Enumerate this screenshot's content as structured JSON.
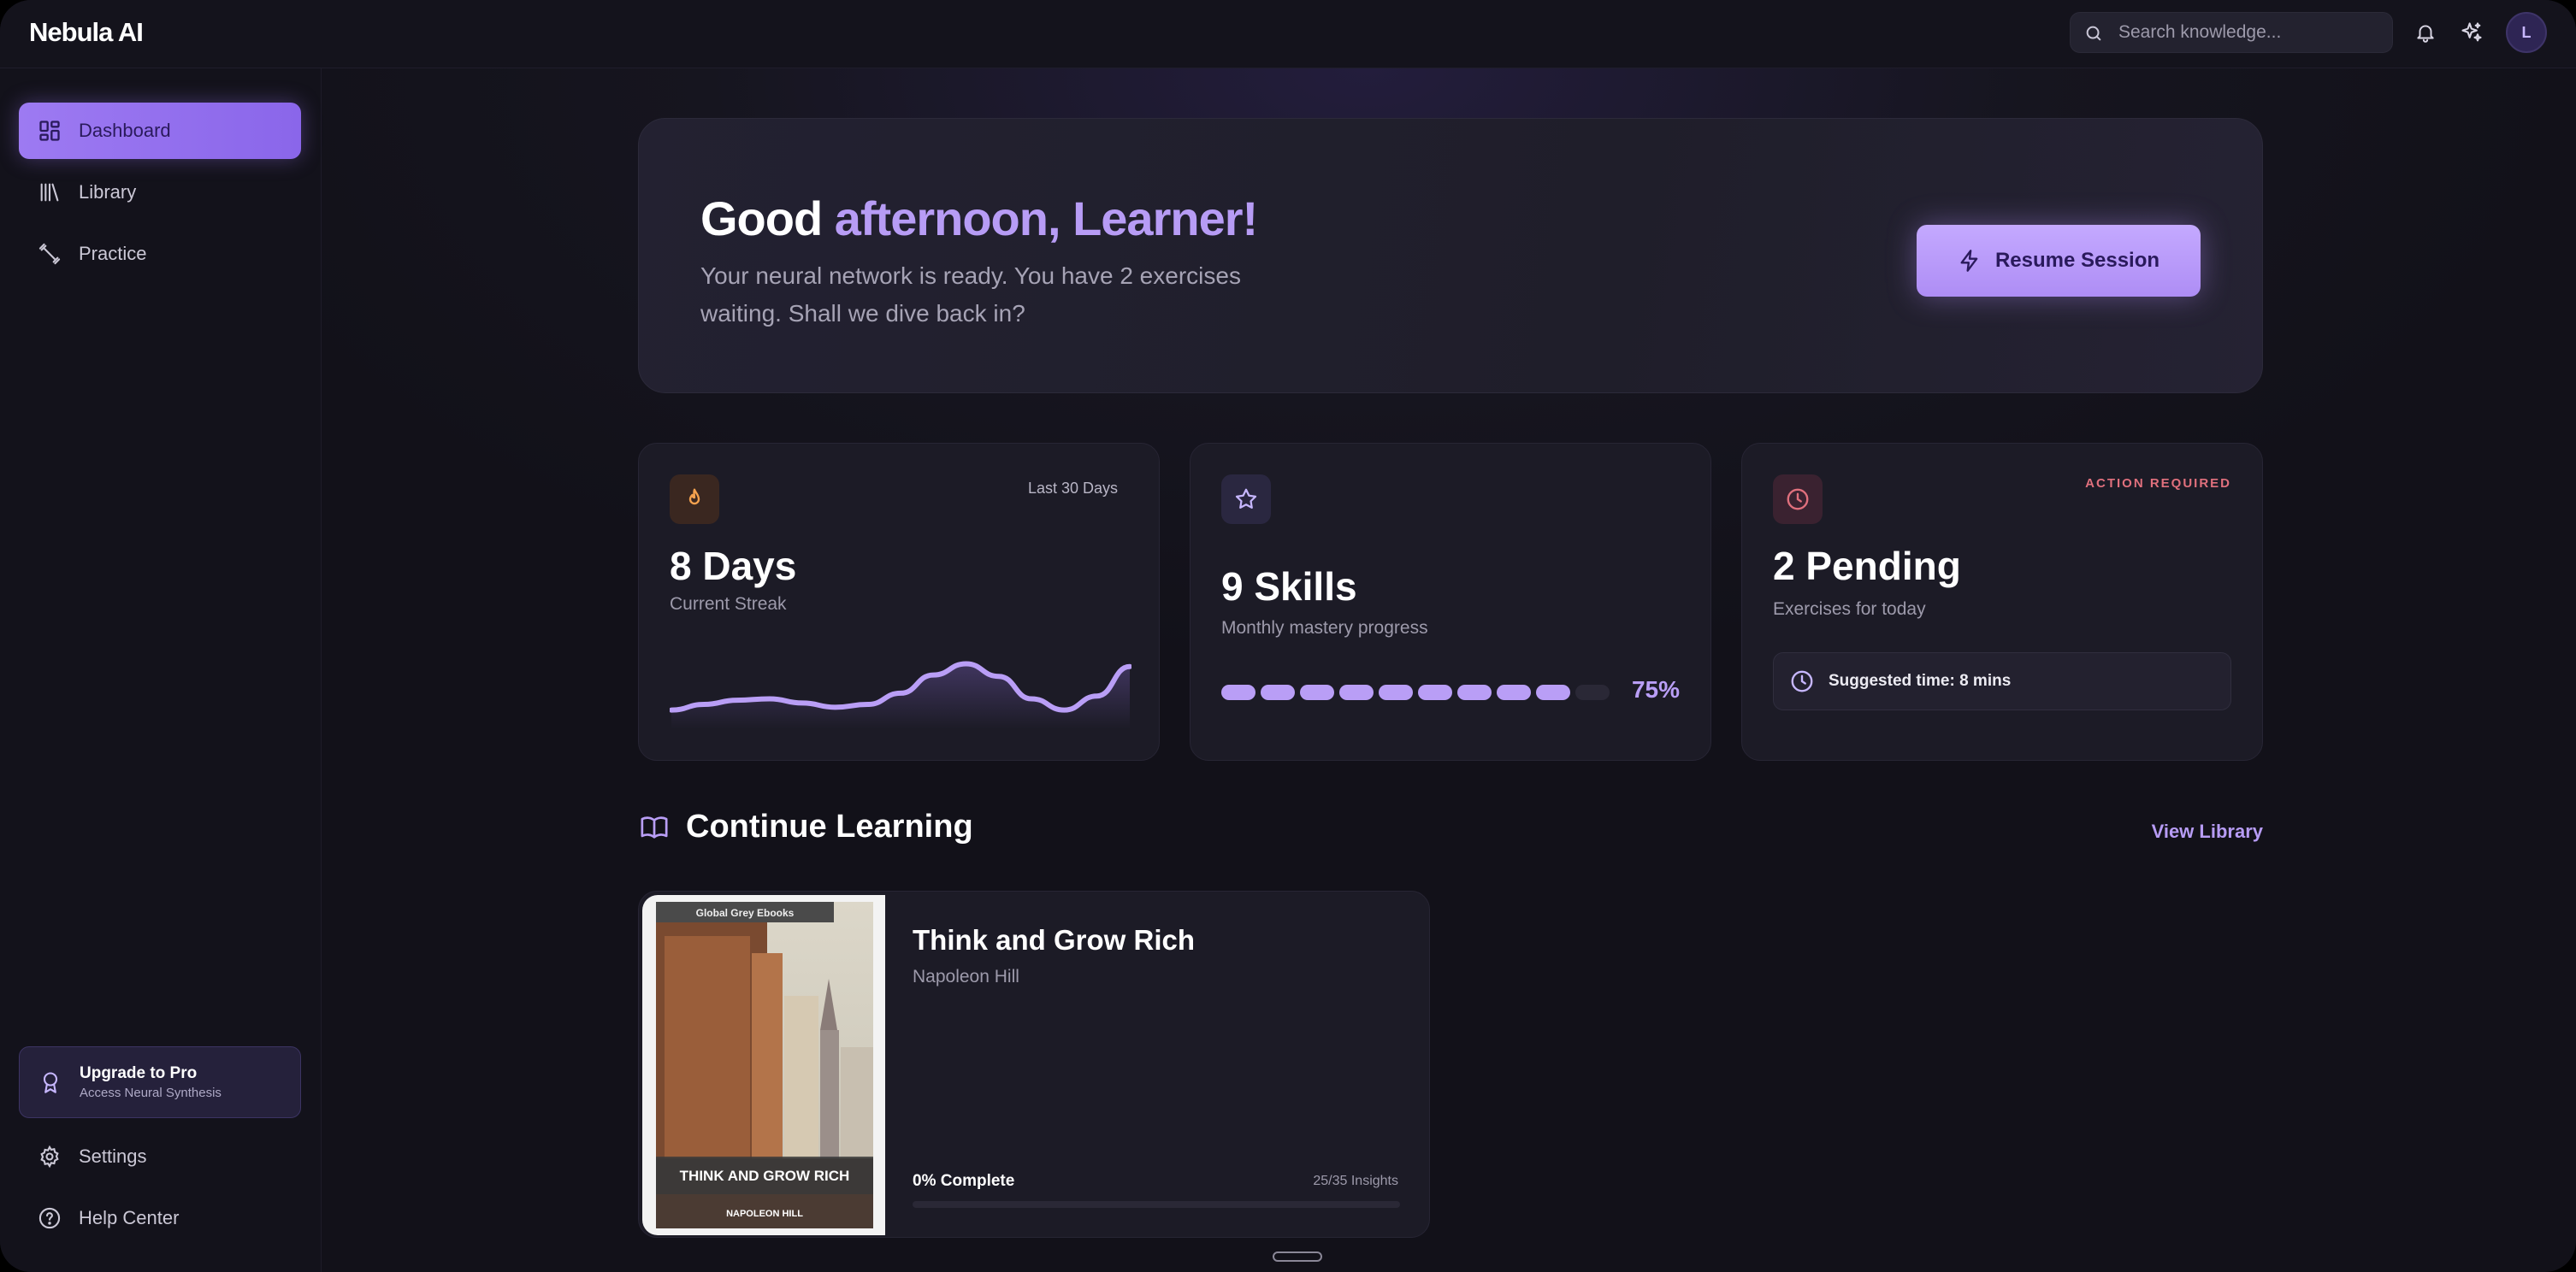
{
  "app": {
    "brand": "Nebula AI",
    "search_placeholder": "Search knowledge...",
    "avatar_initial": "L"
  },
  "sidebar": {
    "items": [
      {
        "label": "Dashboard",
        "icon": "grid-icon",
        "active": true
      },
      {
        "label": "Library",
        "icon": "library-icon",
        "active": false
      },
      {
        "label": "Practice",
        "icon": "dumbbell-icon",
        "active": false
      }
    ],
    "upgrade": {
      "title": "Upgrade to Pro",
      "subtitle": "Access Neural Synthesis",
      "icon": "award-icon"
    },
    "footer": [
      {
        "label": "Settings",
        "icon": "gear-icon"
      },
      {
        "label": "Help Center",
        "icon": "help-icon"
      }
    ]
  },
  "hero": {
    "greeting_prefix": "Good",
    "greeting_accent": "afternoon, Learner!",
    "message": "Your neural network is ready. You have 2 exercises waiting. Shall we dive back in?",
    "button_label": "Resume Session"
  },
  "stats": {
    "streak": {
      "tag": "Last 30 Days",
      "value": "8 Days",
      "label": "Current Streak",
      "icon": "flame-icon",
      "sparkline": [
        20,
        28,
        34,
        36,
        30,
        24,
        28,
        44,
        70,
        86,
        68,
        36,
        20,
        40,
        82
      ]
    },
    "skills": {
      "value": "9 Skills",
      "label": "Monthly mastery progress",
      "percent_label": "75%",
      "segments_total": 10,
      "segments_filled": 9,
      "icon": "star-icon"
    },
    "pending": {
      "badge": "ACTION REQUIRED",
      "value": "2 Pending",
      "label": "Exercises for today",
      "suggestion": "Suggested time: 8 mins",
      "icon": "clock-icon"
    }
  },
  "continue_learning": {
    "title": "Continue Learning",
    "link": "View Library",
    "book": {
      "title": "Think and Grow Rich",
      "author": "Napoleon Hill",
      "cover_publisher": "Global Grey Ebooks",
      "cover_title": "THINK AND GROW RICH",
      "cover_author": "NAPOLEON HILL",
      "progress_label": "0% Complete",
      "progress": 0,
      "insights": "25/35 Insights"
    }
  },
  "colors": {
    "accent": "#b79cf5",
    "accent_button": "#9d7af2",
    "warning": "#e0707d",
    "flame": "#f4a14e"
  }
}
